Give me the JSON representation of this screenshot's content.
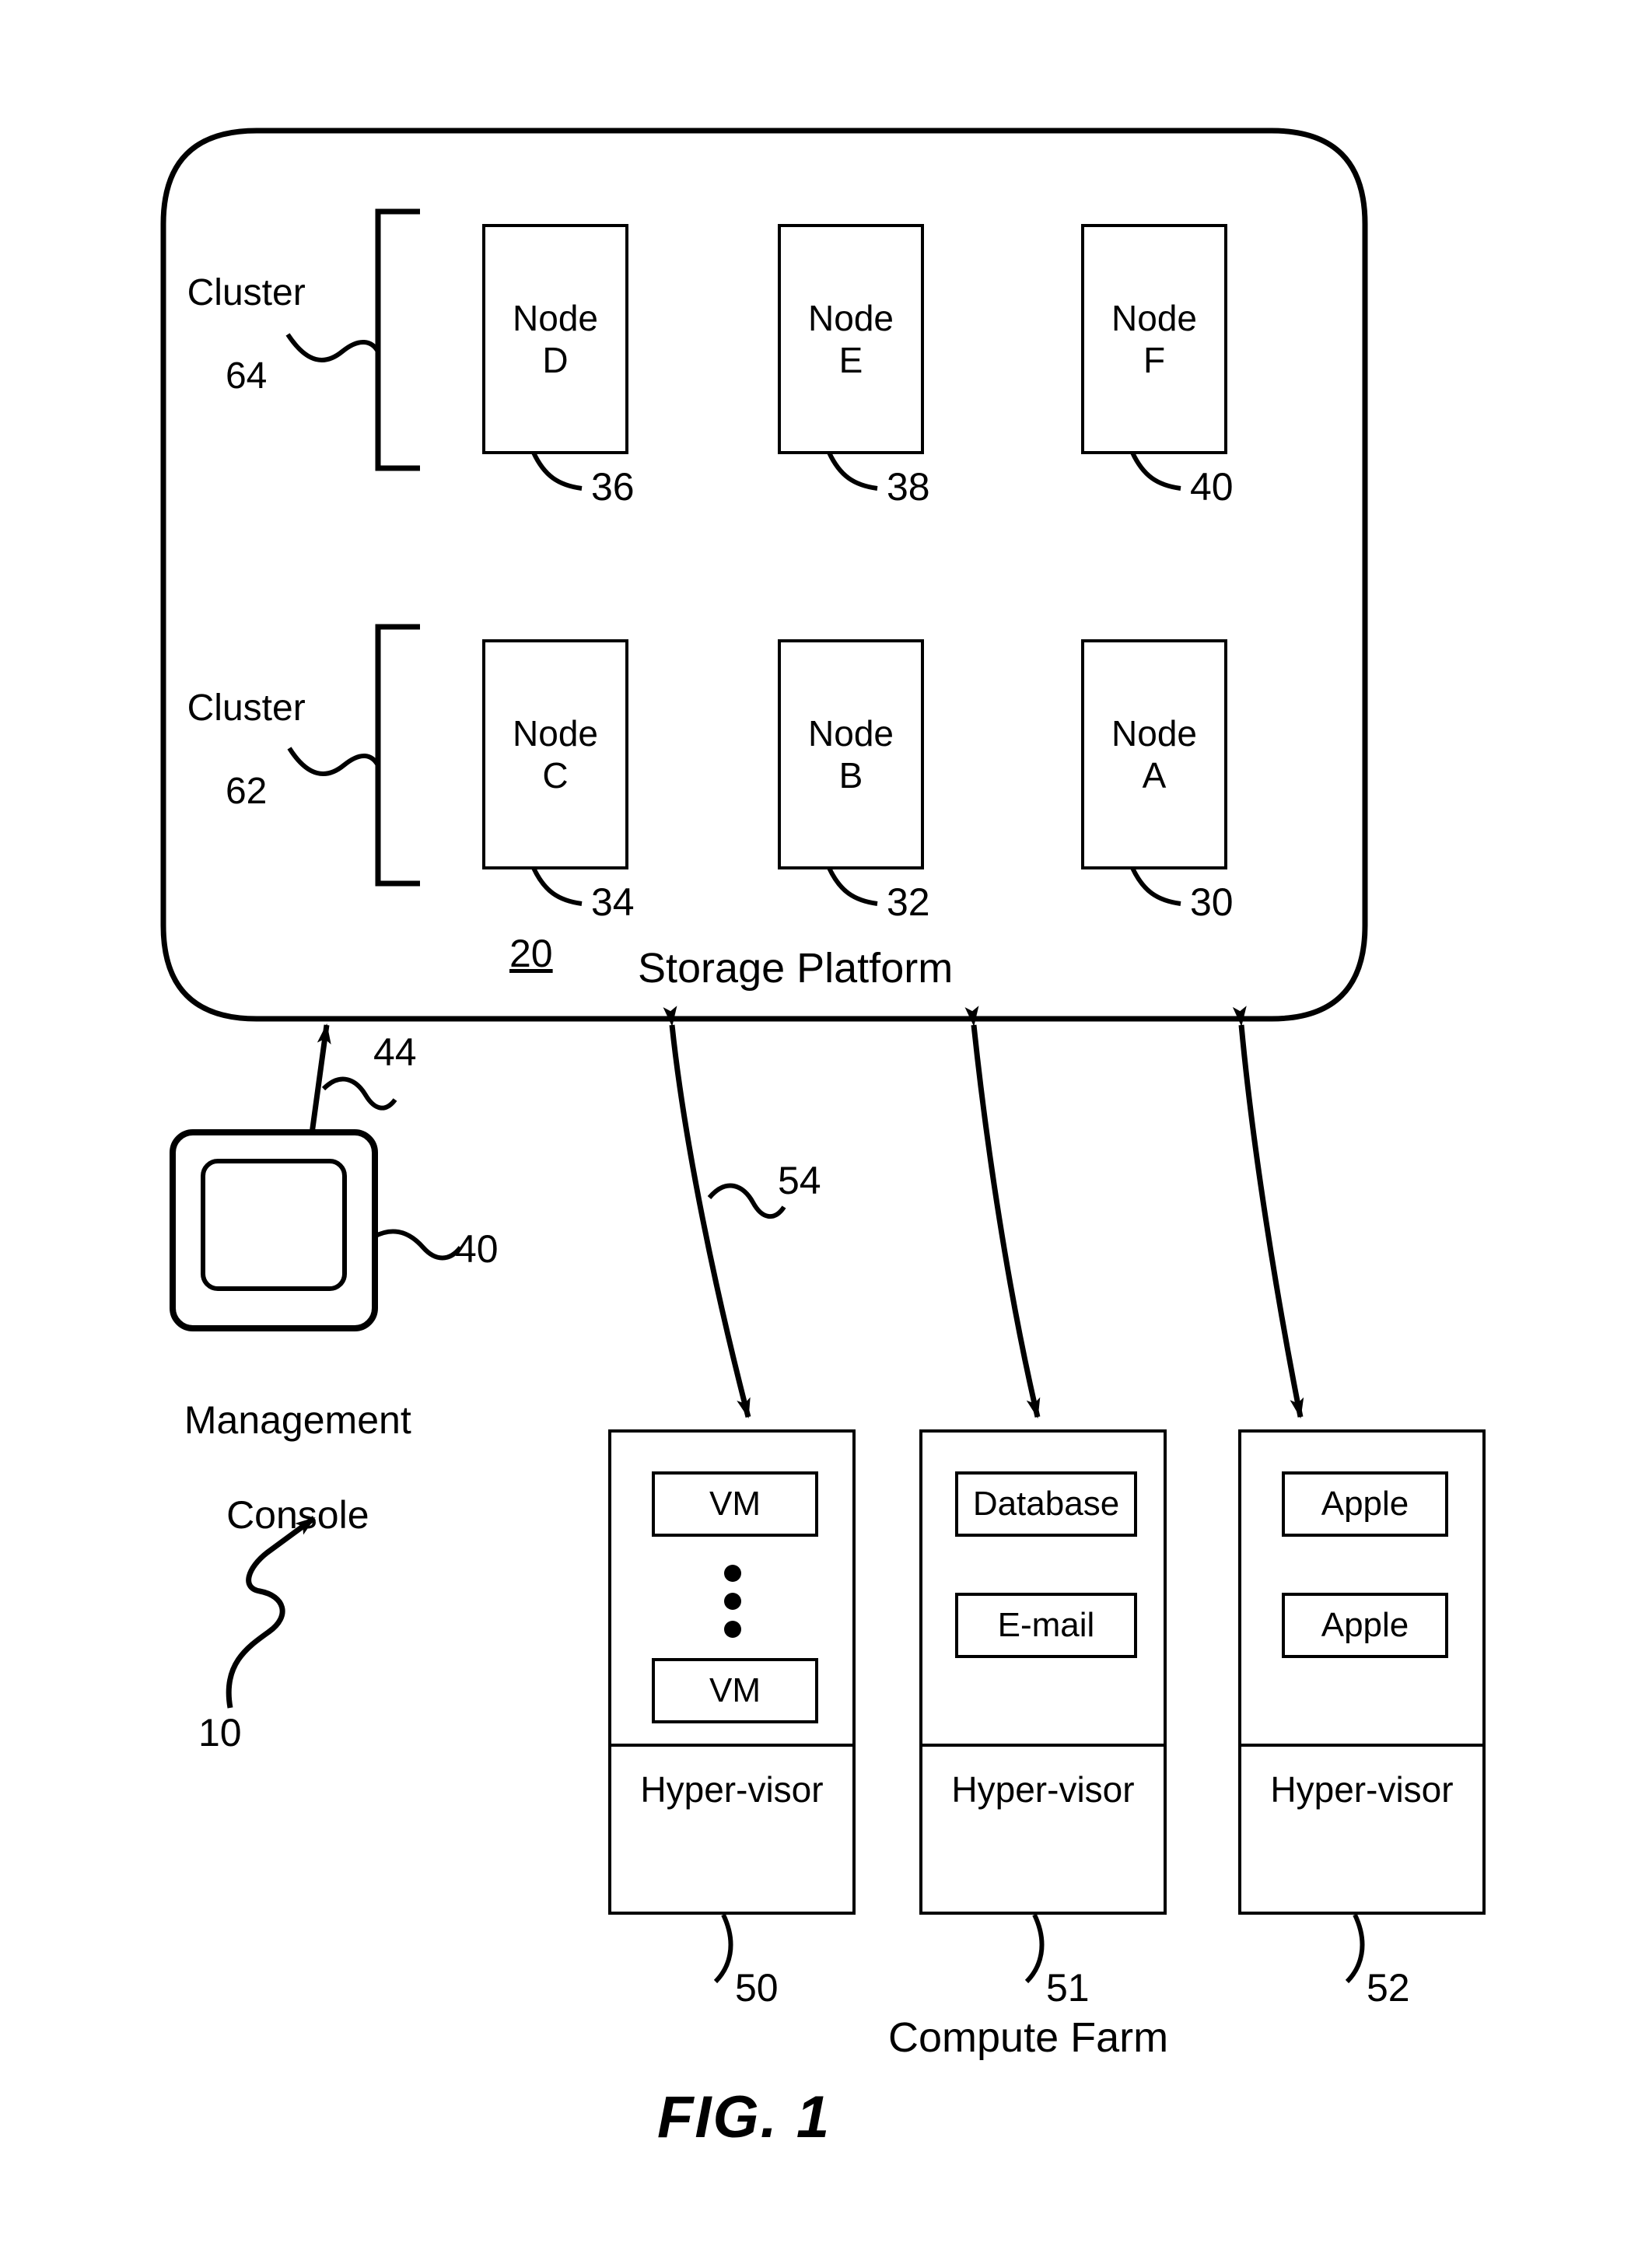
{
  "figure": {
    "caption": "FIG. 1",
    "system_ref": "10"
  },
  "storage_platform": {
    "title": "Storage Platform",
    "ref": "20",
    "clusters": [
      {
        "label": "Cluster",
        "ref": "64",
        "nodes": [
          {
            "name": "Node",
            "id": "D",
            "ref": "36"
          },
          {
            "name": "Node",
            "id": "E",
            "ref": "38"
          },
          {
            "name": "Node",
            "id": "F",
            "ref": "40"
          }
        ]
      },
      {
        "label": "Cluster",
        "ref": "62",
        "nodes": [
          {
            "name": "Node",
            "id": "C",
            "ref": "34"
          },
          {
            "name": "Node",
            "id": "B",
            "ref": "32"
          },
          {
            "name": "Node",
            "id": "A",
            "ref": "30"
          }
        ]
      }
    ]
  },
  "management_console": {
    "label_line1": "Management",
    "label_line2": "Console",
    "ref": "40",
    "link_ref": "44"
  },
  "compute_farm": {
    "label": "Compute Farm",
    "link_ref": "54",
    "hypervisor_label": "Hyper-visor",
    "servers": [
      {
        "ref": "50",
        "apps": [
          "VM",
          "VM"
        ],
        "has_ellipsis": true
      },
      {
        "ref": "51",
        "apps": [
          "Database",
          "E-mail"
        ],
        "has_ellipsis": false
      },
      {
        "ref": "52",
        "apps": [
          "Apple",
          "Apple"
        ],
        "has_ellipsis": false
      }
    ]
  },
  "colors": {
    "stroke": "#000000",
    "background": "#ffffff"
  }
}
